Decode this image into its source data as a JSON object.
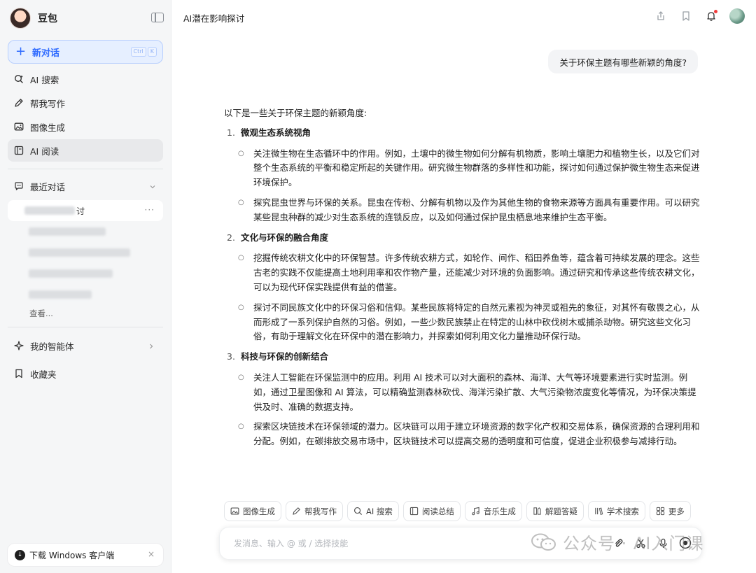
{
  "sidebar": {
    "app_name": "豆包",
    "new_chat": {
      "label": "新对话",
      "shortcut": [
        "Ctrl",
        "K"
      ]
    },
    "nav": [
      {
        "label": "AI 搜索",
        "icon": "ai-search-icon"
      },
      {
        "label": "帮我写作",
        "icon": "pen-icon"
      },
      {
        "label": "图像生成",
        "icon": "image-icon"
      },
      {
        "label": "AI 阅读",
        "icon": "book-icon"
      }
    ],
    "recent_label": "最近对话",
    "history": [
      {
        "label": "讨",
        "more": "···"
      },
      {
        "label": ""
      },
      {
        "label": ""
      },
      {
        "label": ""
      },
      {
        "label": ""
      }
    ],
    "view_all": "查看...",
    "agents_label": "我的智能体",
    "favorites_label": "收藏夹",
    "download": {
      "label": "下载 Windows 客户端",
      "close": "×"
    }
  },
  "main": {
    "title": "AI潜在影响探讨",
    "user_message": "关于环保主题有哪些新颖的角度?",
    "answer": {
      "intro": "以下是一些关于环保主题的新颖角度:",
      "sections": [
        {
          "num": "1.",
          "title": "微观生态系统视角",
          "bullets": [
            "关注微生物在生态循环中的作用。例如，土壤中的微生物如何分解有机物质，影响土壤肥力和植物生长，以及它们对整个生态系统的平衡和稳定所起的关键作用。研究微生物群落的多样性和功能，探讨如何通过保护微生物生态来促进环境保护。",
            "探究昆虫世界与环保的关系。昆虫在传粉、分解有机物以及作为其他生物的食物来源等方面具有重要作用。可以研究某些昆虫种群的减少对生态系统的连锁反应，以及如何通过保护昆虫栖息地来维护生态平衡。"
          ]
        },
        {
          "num": "2.",
          "title": "文化与环保的融合角度",
          "bullets": [
            "挖掘传统农耕文化中的环保智慧。许多传统农耕方式，如轮作、间作、稻田养鱼等，蕴含着可持续发展的理念。这些古老的实践不仅能提高土地利用率和农作物产量，还能减少对环境的负面影响。通过研究和传承这些传统农耕文化，可以为现代环保实践提供有益的借鉴。",
            "探讨不同民族文化中的环保习俗和信仰。某些民族将特定的自然元素视为神灵或祖先的象征，对其怀有敬畏之心，从而形成了一系列保护自然的习俗。例如，一些少数民族禁止在特定的山林中砍伐树木或捕杀动物。研究这些文化习俗，有助于理解文化在环保中的潜在影响力，并探索如何利用文化力量推动环保行动。"
          ]
        },
        {
          "num": "3.",
          "title": "科技与环保的创新结合",
          "bullets": [
            "关注人工智能在环保监测中的应用。利用 AI 技术可以对大面积的森林、海洋、大气等环境要素进行实时监测。例如，通过卫星图像和 AI 算法，可以精确监测森林砍伐、海洋污染扩散、大气污染物浓度变化等情况，为环保决策提供及时、准确的数据支持。",
            "探索区块链技术在环保领域的潜力。区块链可以用于建立环境资源的数字化产权和交易体系，确保资源的合理利用和分配。例如，在碳排放交易市场中，区块链技术可以提高交易的透明度和可信度，促进企业积极参与减排行动。"
          ]
        }
      ]
    },
    "skills": [
      {
        "label": "图像生成",
        "icon": "image-icon"
      },
      {
        "label": "帮我写作",
        "icon": "pen-icon"
      },
      {
        "label": "AI 搜索",
        "icon": "ai-search-icon"
      },
      {
        "label": "阅读总结",
        "icon": "book-icon"
      },
      {
        "label": "音乐生成",
        "icon": "music-icon"
      },
      {
        "label": "解题答疑",
        "icon": "pencil-ruler-icon"
      },
      {
        "label": "学术搜索",
        "icon": "library-icon"
      },
      {
        "label": "更多",
        "icon": "grid-icon"
      }
    ],
    "input": {
      "placeholder": "发消息、输入 @ 或 / 选择技能"
    }
  },
  "watermark": {
    "text": "公众号 · AI入门课"
  },
  "colors": {
    "accent": "#2f6bff",
    "sidebar_bg": "#f5f6f7",
    "bubble_bg": "#f3f4f6",
    "notify": "#f23b3b"
  }
}
